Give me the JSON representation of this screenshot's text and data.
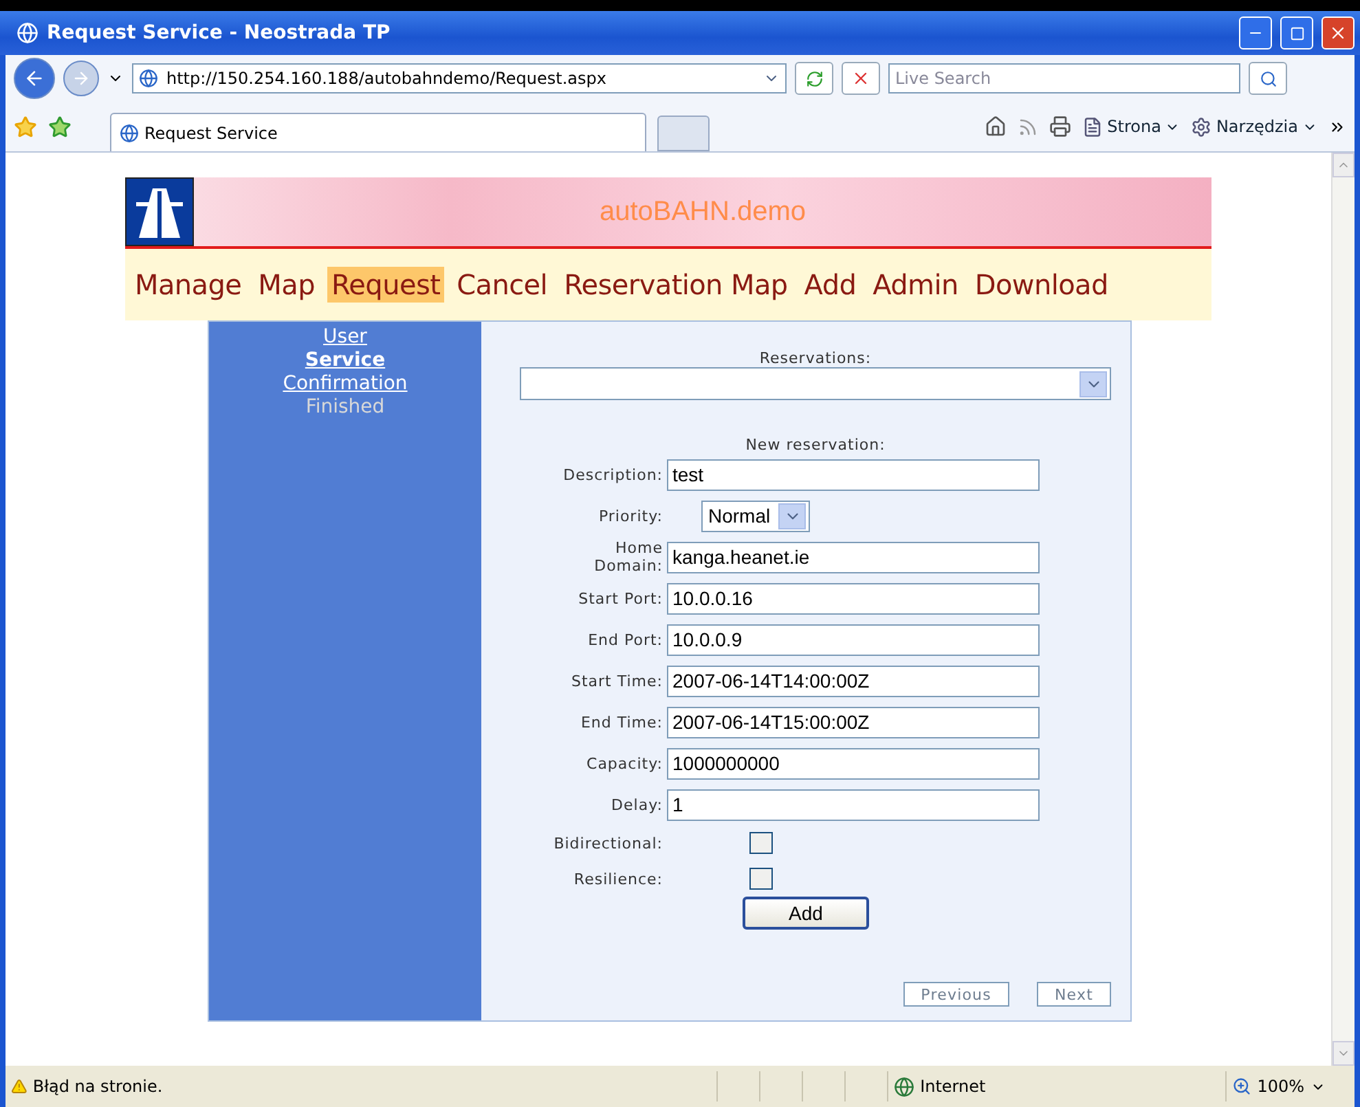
{
  "window": {
    "title": "Request Service - Neostrada TP"
  },
  "address_bar": {
    "url": "http://150.254.160.188/autobahndemo/Request.aspx",
    "search_placeholder": "Live Search"
  },
  "browser_tab": {
    "title": "Request Service"
  },
  "toolbar": [
    {
      "label": "Strona"
    },
    {
      "label": "Narzędzia"
    }
  ],
  "site": {
    "title": "autoBAHN.demo"
  },
  "nav": [
    {
      "label": "Manage",
      "selected": false
    },
    {
      "label": "Map",
      "selected": false
    },
    {
      "label": "Request",
      "selected": true
    },
    {
      "label": "Cancel",
      "selected": false
    },
    {
      "label": "Reservation Map",
      "selected": false
    },
    {
      "label": "Add",
      "selected": false
    },
    {
      "label": "Admin",
      "selected": false
    },
    {
      "label": "Download",
      "selected": false
    }
  ],
  "steps": [
    {
      "label": "User",
      "kind": "link"
    },
    {
      "label": "Service",
      "kind": "current"
    },
    {
      "label": "Confirmation",
      "kind": "link"
    },
    {
      "label": "Finished",
      "kind": "disabled"
    }
  ],
  "form": {
    "reservations_label": "Reservations:",
    "section_title": "New reservation:",
    "fields": [
      {
        "label": "Description:",
        "kind": "text",
        "value": "test"
      },
      {
        "label": "Priority:",
        "kind": "select",
        "value": "Normal"
      },
      {
        "label": "Home\nDomain:",
        "kind": "text",
        "value": "kanga.heanet.ie"
      },
      {
        "label": "Start Port:",
        "kind": "text",
        "value": "10.0.0.16"
      },
      {
        "label": "End Port:",
        "kind": "text",
        "value": "10.0.0.9"
      },
      {
        "label": "Start Time:",
        "kind": "text",
        "value": "2007-06-14T14:00:00Z"
      },
      {
        "label": "End Time:",
        "kind": "text",
        "value": "2007-06-14T15:00:00Z"
      },
      {
        "label": "Capacity:",
        "kind": "text",
        "value": "1000000000"
      },
      {
        "label": "Delay:",
        "kind": "text",
        "value": "1"
      },
      {
        "label": "Bidirectional:",
        "kind": "checkbox",
        "checked": false
      },
      {
        "label": "Resilience:",
        "kind": "checkbox",
        "checked": false
      }
    ],
    "add_button": "Add",
    "previous_button": "Previous",
    "next_button": "Next"
  },
  "status_bar": {
    "message": "Błąd na stronie.",
    "zone": "Internet",
    "zoom": "100%"
  }
}
